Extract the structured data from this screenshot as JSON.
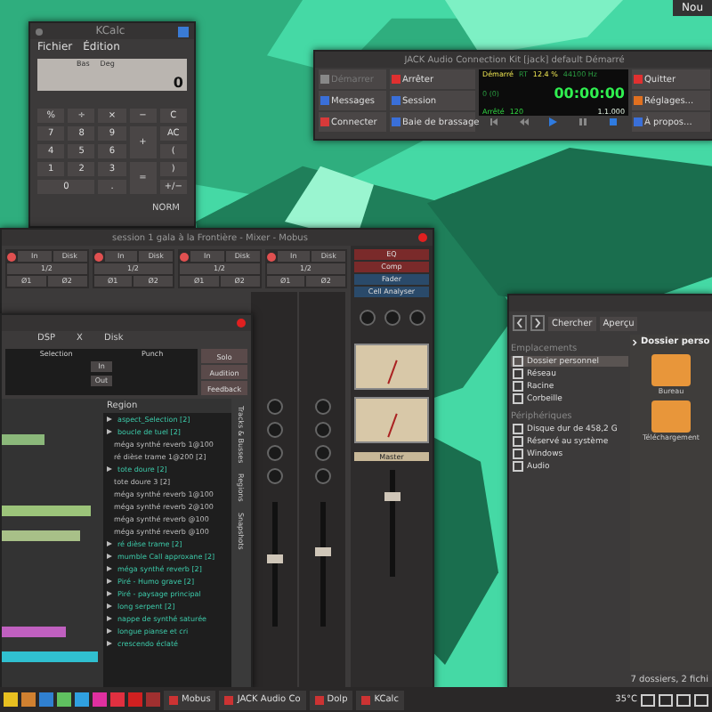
{
  "corner_label": "Nou",
  "kcalc": {
    "title": "KCalc",
    "menu": [
      "Fichier",
      "Édition"
    ],
    "indicators": [
      "Bas",
      "Deg"
    ],
    "display": "0",
    "status": "NORM",
    "keys": [
      {
        "label": "%",
        "kind": "normal"
      },
      {
        "label": "÷",
        "kind": "normal"
      },
      {
        "label": "×",
        "kind": "normal"
      },
      {
        "label": "−",
        "kind": "normal"
      },
      {
        "label": "C",
        "kind": "normal"
      },
      {
        "label": "7",
        "kind": "normal"
      },
      {
        "label": "8",
        "kind": "normal"
      },
      {
        "label": "9",
        "kind": "normal"
      },
      {
        "label": "+",
        "kind": "tall"
      },
      {
        "label": "AC",
        "kind": "normal"
      },
      {
        "label": "4",
        "kind": "normal"
      },
      {
        "label": "5",
        "kind": "normal"
      },
      {
        "label": "6",
        "kind": "normal"
      },
      {
        "label": "(",
        "kind": "normal"
      },
      {
        "label": "1",
        "kind": "normal"
      },
      {
        "label": "2",
        "kind": "normal"
      },
      {
        "label": "3",
        "kind": "normal"
      },
      {
        "label": "=",
        "kind": "tall"
      },
      {
        "label": ")",
        "kind": "normal"
      },
      {
        "label": "0",
        "kind": "wide"
      },
      {
        "label": ".",
        "kind": "normal"
      },
      {
        "label": "+/−",
        "kind": "normal"
      }
    ]
  },
  "jack": {
    "title": "JACK Audio Connection Kit [jack] default Démarré",
    "left_buttons": [
      {
        "label": "Démarrer",
        "disabled": true,
        "color": "#888888"
      },
      {
        "label": "Messages",
        "disabled": false,
        "color": "#3a6fd8"
      },
      {
        "label": "Connecter",
        "disabled": false,
        "color": "#d83a3a"
      }
    ],
    "mid_buttons": [
      {
        "label": "Arrêter",
        "disabled": false,
        "color": "#e03030"
      },
      {
        "label": "Session",
        "disabled": false,
        "color": "#3a6fd8"
      },
      {
        "label": "Baie de brassage",
        "disabled": false,
        "color": "#3a6fd8"
      }
    ],
    "right_buttons": [
      {
        "label": "Quitter",
        "disabled": false,
        "color": "#e03030"
      },
      {
        "label": "Réglages...",
        "disabled": false,
        "color": "#e07020"
      },
      {
        "label": "À propos...",
        "disabled": false,
        "color": "#3a6fd8"
      }
    ],
    "status": "Démarré",
    "rt": "RT",
    "dsp": "12.4 %",
    "rate": "44100 Hz",
    "xruns": "0 (0)",
    "time": "00:00:00",
    "transport": "Arrêté",
    "bpm": "120",
    "bbt": "1.1.000"
  },
  "mixer": {
    "title": "session 1 gala à la Frontière - Mixer - Mobus",
    "strips": [
      {
        "input": "In",
        "disk": "Disk",
        "routing": "1/2",
        "phases": [
          "Ø1",
          "Ø2"
        ]
      },
      {
        "input": "In",
        "disk": "Disk",
        "routing": "1/2",
        "phases": [
          "Ø1",
          "Ø2"
        ]
      },
      {
        "input": "In",
        "disk": "Disk",
        "routing": "1/2",
        "phases": [
          "Ø1",
          "Ø2"
        ]
      },
      {
        "input": "In",
        "disk": "Disk",
        "routing": "1/2",
        "phases": [
          "Ø1",
          "Ø2"
        ]
      }
    ],
    "plugins": [
      "EQ",
      "Comp",
      "Fader",
      "Cell Analyser"
    ],
    "master": "Master",
    "faders": [
      {
        "level": 0.55
      },
      {
        "level": 0.6
      },
      {
        "level": 0.75
      }
    ]
  },
  "editor": {
    "dsp": "DSP",
    "x": "X",
    "disk": "Disk",
    "selection": "Selection",
    "punch": "Punch",
    "punch_buttons": [
      "In",
      "Out"
    ],
    "buttons": [
      "Solo",
      "Audition",
      "Feedback"
    ],
    "region_header": "Region",
    "regions": [
      {
        "name": "aspect_Selection [2]"
      },
      {
        "name": "boucle de tuel [2]",
        "children": [
          {
            "name": "méga synthé reverb 1@100"
          },
          {
            "name": "ré dièse trame 1@200 [2]"
          }
        ]
      },
      {
        "name": "tote doure [2]",
        "children": [
          {
            "name": "tote doure 3 [2]"
          },
          {
            "name": "méga synthé reverb 1@100"
          },
          {
            "name": "méga synthé reverb 2@100"
          },
          {
            "name": "méga synthé reverb @100"
          },
          {
            "name": "méga synthé reverb @100"
          }
        ]
      },
      {
        "name": "ré dièse trame [2]"
      },
      {
        "name": "mumble Call approxane [2]"
      },
      {
        "name": "méga synthé reverb [2]"
      },
      {
        "name": "Piré - Humo grave [2]"
      },
      {
        "name": "Piré - paysage principal"
      },
      {
        "name": "long serpent [2]"
      },
      {
        "name": "nappe de synthé saturée"
      },
      {
        "name": "longue pianse et cri"
      },
      {
        "name": "crescendo éclaté"
      }
    ],
    "tabs": [
      "Tracks & Busses",
      "Regions",
      "Snapshots"
    ]
  },
  "dolphin": {
    "toolbar": [
      "Chercher",
      "Aperçu"
    ],
    "breadcrumb": "Dossier perso",
    "sections": [
      {
        "title": "Emplacements",
        "items": [
          {
            "label": "Dossier personnel",
            "selected": true
          },
          {
            "label": "Réseau",
            "selected": false
          },
          {
            "label": "Racine",
            "selected": false
          },
          {
            "label": "Corbeille",
            "selected": false
          }
        ]
      },
      {
        "title": "Périphériques",
        "items": [
          {
            "label": "Disque dur de 458,2 G",
            "selected": false
          },
          {
            "label": "Réservé au système",
            "selected": false
          },
          {
            "label": "Windows",
            "selected": false
          },
          {
            "label": "Audio",
            "selected": false
          }
        ]
      }
    ],
    "folders": [
      "Bureau",
      "Téléchargement"
    ],
    "status": "7 dossiers, 2 fichi"
  },
  "taskbar": {
    "launchers": [
      {
        "color": "#e8c020"
      },
      {
        "color": "#d08030"
      },
      {
        "color": "#3080d0"
      },
      {
        "color": "#60c060"
      },
      {
        "color": "#30a0e0"
      },
      {
        "color": "#e030a0"
      },
      {
        "color": "#e03040"
      },
      {
        "color": "#d02020"
      },
      {
        "color": "#a03030"
      }
    ],
    "tasks": [
      "Mobus",
      "JACK Audio Co",
      "Dolp",
      "KCalc"
    ],
    "temperature": "35°C"
  }
}
